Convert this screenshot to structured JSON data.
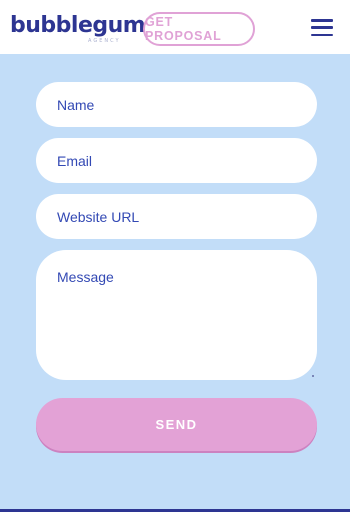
{
  "header": {
    "logo": "bubblegum",
    "logo_sub": "AGENCY",
    "proposal_label": "GET PROPOSAL"
  },
  "form": {
    "name_placeholder": "Name",
    "email_placeholder": "Email",
    "website_placeholder": "Website URL",
    "message_placeholder": "Message",
    "send_label": "SEND"
  },
  "colors": {
    "brand_navy": "#2d3592",
    "bubblegum_pink": "#e3a2d6",
    "background_blue": "#c2ddf8",
    "field_text": "#3349b4"
  },
  "icons": {
    "menu": "hamburger-menu-icon"
  }
}
